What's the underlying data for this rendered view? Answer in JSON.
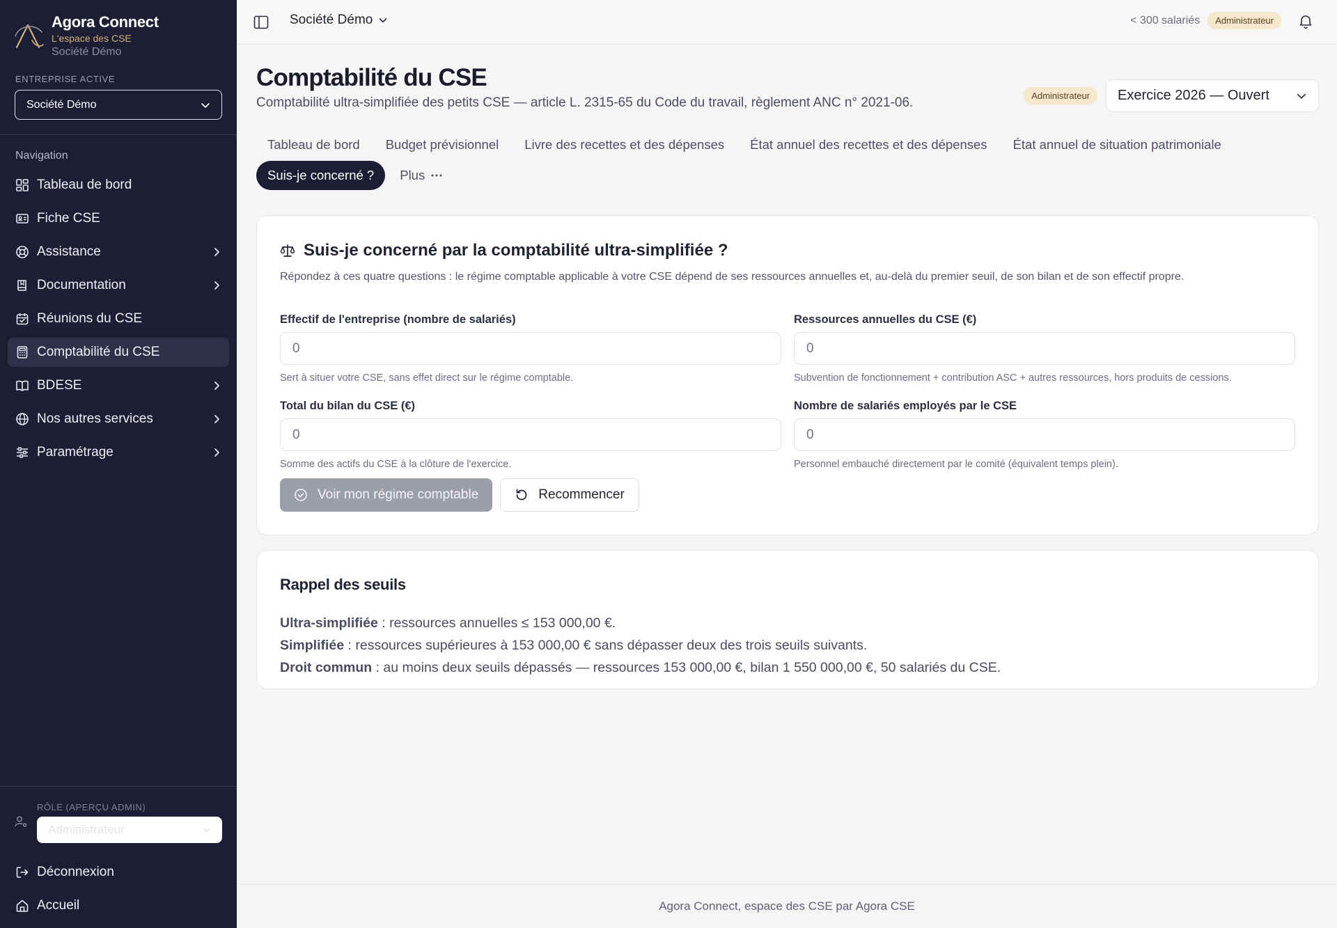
{
  "sidebar": {
    "brand_name": "Agora Connect",
    "brand_tagline": "L'espace des CSE",
    "brand_company": "Société Démo",
    "active_company_label": "ENTREPRISE ACTIVE",
    "active_company_value": "Société Démo",
    "nav_label": "Navigation",
    "nav_items": [
      {
        "label": "Tableau de bord",
        "icon": "dashboard-icon",
        "has_arrow": false
      },
      {
        "label": "Fiche CSE",
        "icon": "id-card-icon",
        "has_arrow": false
      },
      {
        "label": "Assistance",
        "icon": "lifebuoy-icon",
        "has_arrow": true
      },
      {
        "label": "Documentation",
        "icon": "book-icon",
        "has_arrow": true
      },
      {
        "label": "Réunions du CSE",
        "icon": "calendar-check-icon",
        "has_arrow": false
      },
      {
        "label": "Comptabilité du CSE",
        "icon": "calculator-icon",
        "has_arrow": false,
        "active": true
      },
      {
        "label": "BDESE",
        "icon": "open-book-icon",
        "has_arrow": true
      },
      {
        "label": "Nos autres services",
        "icon": "globe-icon",
        "has_arrow": true
      },
      {
        "label": "Paramétrage",
        "icon": "sliders-icon",
        "has_arrow": true
      }
    ],
    "role_label": "RÔLE (APERÇU ADMIN)",
    "role_value": "Administrateur",
    "logout_label": "Déconnexion",
    "home_label": "Accueil"
  },
  "topbar": {
    "company": "Société Démo",
    "employees": "< 300 salariés",
    "role_badge": "Administrateur"
  },
  "header": {
    "title": "Comptabilité du CSE",
    "subtitle": "Comptabilité ultra-simplifiée des petits CSE — article L. 2315-65 du Code du travail, règlement ANC n° 2021-06.",
    "role_badge": "Administrateur",
    "exercise": "Exercice 2026 — Ouvert"
  },
  "tabs": {
    "row1": [
      "Tableau de bord",
      "Budget prévisionnel",
      "Livre des recettes et des dépenses",
      "État annuel des recettes et des dépenses",
      "État annuel de situation patrimoniale"
    ],
    "active": "Suis-je concerné ?",
    "more": "Plus"
  },
  "form_card": {
    "title": "Suis-je concerné par la comptabilité ultra-simplifiée ?",
    "description": "Répondez à ces quatre questions : le régime comptable applicable à votre CSE dépend de ses ressources annuelles et, au-delà du premier seuil, de son bilan et de son effectif propre.",
    "fields": [
      {
        "label": "Effectif de l'entreprise (nombre de salariés)",
        "value": "0",
        "help": "Sert à situer votre CSE, sans effet direct sur le régime comptable."
      },
      {
        "label": "Ressources annuelles du CSE (€)",
        "value": "0",
        "help": "Subvention de fonctionnement + contribution ASC + autres ressources, hors produits de cessions."
      },
      {
        "label": "Total du bilan du CSE (€)",
        "value": "0",
        "help": "Somme des actifs du CSE à la clôture de l'exercice."
      },
      {
        "label": "Nombre de salariés employés par le CSE",
        "value": "0",
        "help": "Personnel embauché directement par le comité (équivalent temps plein)."
      }
    ],
    "submit_label": "Voir mon régime comptable",
    "reset_label": "Recommencer"
  },
  "thresholds_card": {
    "title": "Rappel des seuils",
    "rules": [
      {
        "term": "Ultra-simplifiée",
        "text": " : ressources annuelles ≤ 153 000,00 €."
      },
      {
        "term": "Simplifiée",
        "text": " : ressources supérieures à 153 000,00 € sans dépasser deux des trois seuils suivants."
      },
      {
        "term": "Droit commun",
        "text": " : au moins deux seuils dépassés — ressources 153 000,00 €, bilan 1 550 000,00 €, 50 salariés du CSE."
      }
    ]
  },
  "footer": {
    "text": "Agora Connect, espace des CSE par Agora CSE"
  },
  "colors": {
    "sidebar_bg": "#1c1e33",
    "accent_gold": "#d4b07a",
    "badge_bg": "#f6e8cc",
    "active_tab_bg": "#1c1e33"
  }
}
